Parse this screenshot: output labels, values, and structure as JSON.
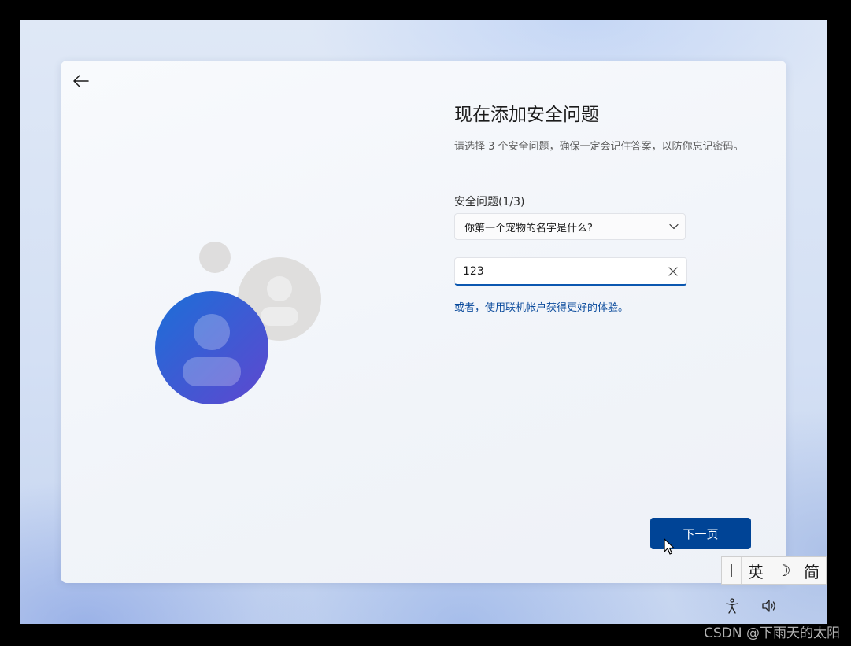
{
  "page": {
    "title": "现在添加安全问题",
    "subtitle": "请选择 3 个安全问题，确保一定会记住答案，以防你忘记密码。",
    "question_label": "安全问题(1/3)",
    "question_selected": "你第一个宠物的名字是什么?",
    "answer_value": "123",
    "link_text": "或者，使用联机帐户获得更好的体验。",
    "next_label": "下一页"
  },
  "ime": {
    "mode_label": "英",
    "moon_glyph": "☽",
    "script_label": "简"
  },
  "watermark": "CSDN @下雨天的太阳",
  "colors": {
    "accent": "#004496",
    "link": "#0a4a9c",
    "avatar_front_start": "#1b6fd8",
    "avatar_front_end": "#5f47cf",
    "avatar_back": "#dfdedd"
  },
  "icons": {
    "back": "arrow-left-icon",
    "dropdown": "chevron-down-icon",
    "clear": "close-icon",
    "accessibility": "accessibility-icon",
    "volume": "volume-icon",
    "cursor": "mouse-pointer-icon"
  }
}
